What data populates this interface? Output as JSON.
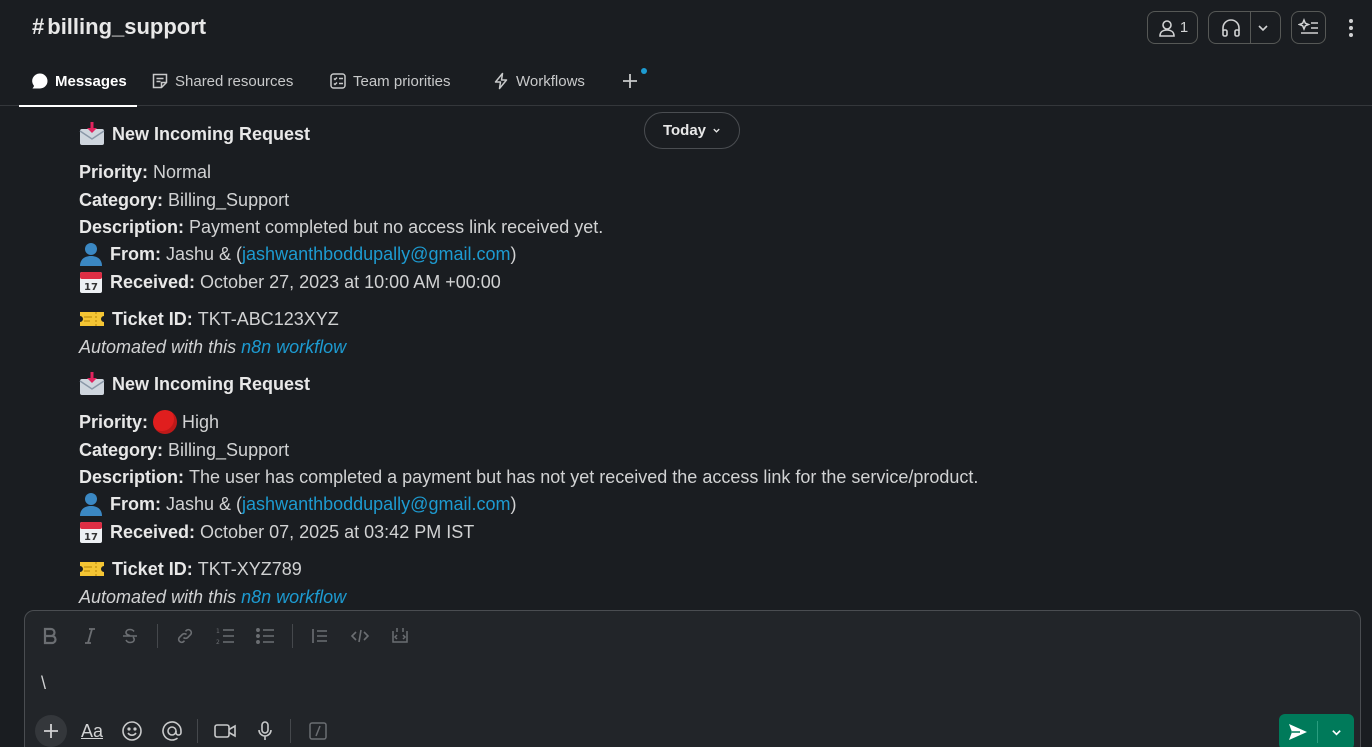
{
  "channel": {
    "hash": "#",
    "name": "billing_support"
  },
  "header": {
    "member_count": "1"
  },
  "tabs": [
    {
      "label": "Messages",
      "icon": "chat-bubble-icon"
    },
    {
      "label": "Shared resources",
      "icon": "canvas-icon"
    },
    {
      "label": "Team priorities",
      "icon": "list-icon"
    },
    {
      "label": "Workflows",
      "icon": "lightning-icon"
    }
  ],
  "date_divider": "Today",
  "messages": [
    {
      "heading": "New Incoming Request",
      "priority_label": "Priority:",
      "priority_value": "Normal",
      "category_label": "Category:",
      "category_value": "Billing_Support",
      "description_label": "Description:",
      "description_value": "Payment completed but no access link received yet.",
      "from_label": "From:",
      "from_name": "Jashu & (",
      "from_email": "jashwanthboddupally@gmail.com",
      "from_close": ")",
      "received_label": "Received:",
      "received_value": "October 27, 2023 at 10:00 AM +00:00",
      "ticket_label": "Ticket ID:",
      "ticket_value": "TKT-ABC123XYZ",
      "automated_text": "Automated with this ",
      "automated_link": "n8n workflow"
    },
    {
      "heading": "New Incoming Request",
      "priority_label": "Priority:",
      "priority_value": "High",
      "category_label": "Category:",
      "category_value": "Billing_Support",
      "description_label": "Description:",
      "description_value": "The user has completed a payment but has not yet received the access link for the service/product.",
      "from_label": "From:",
      "from_name": "Jashu & (",
      "from_email": "jashwanthboddupally@gmail.com",
      "from_close": ")",
      "received_label": "Received:",
      "received_value": "October 07, 2025 at 03:42 PM IST",
      "ticket_label": "Ticket ID:",
      "ticket_value": "TKT-XYZ789",
      "automated_text": "Automated with this ",
      "automated_link": "n8n workflow"
    }
  ],
  "composer": {
    "text": "\\"
  },
  "colors": {
    "background": "#1a1d21",
    "link": "#1d9bd1",
    "send": "#007a5a",
    "priority_high": "#e01e1e"
  }
}
